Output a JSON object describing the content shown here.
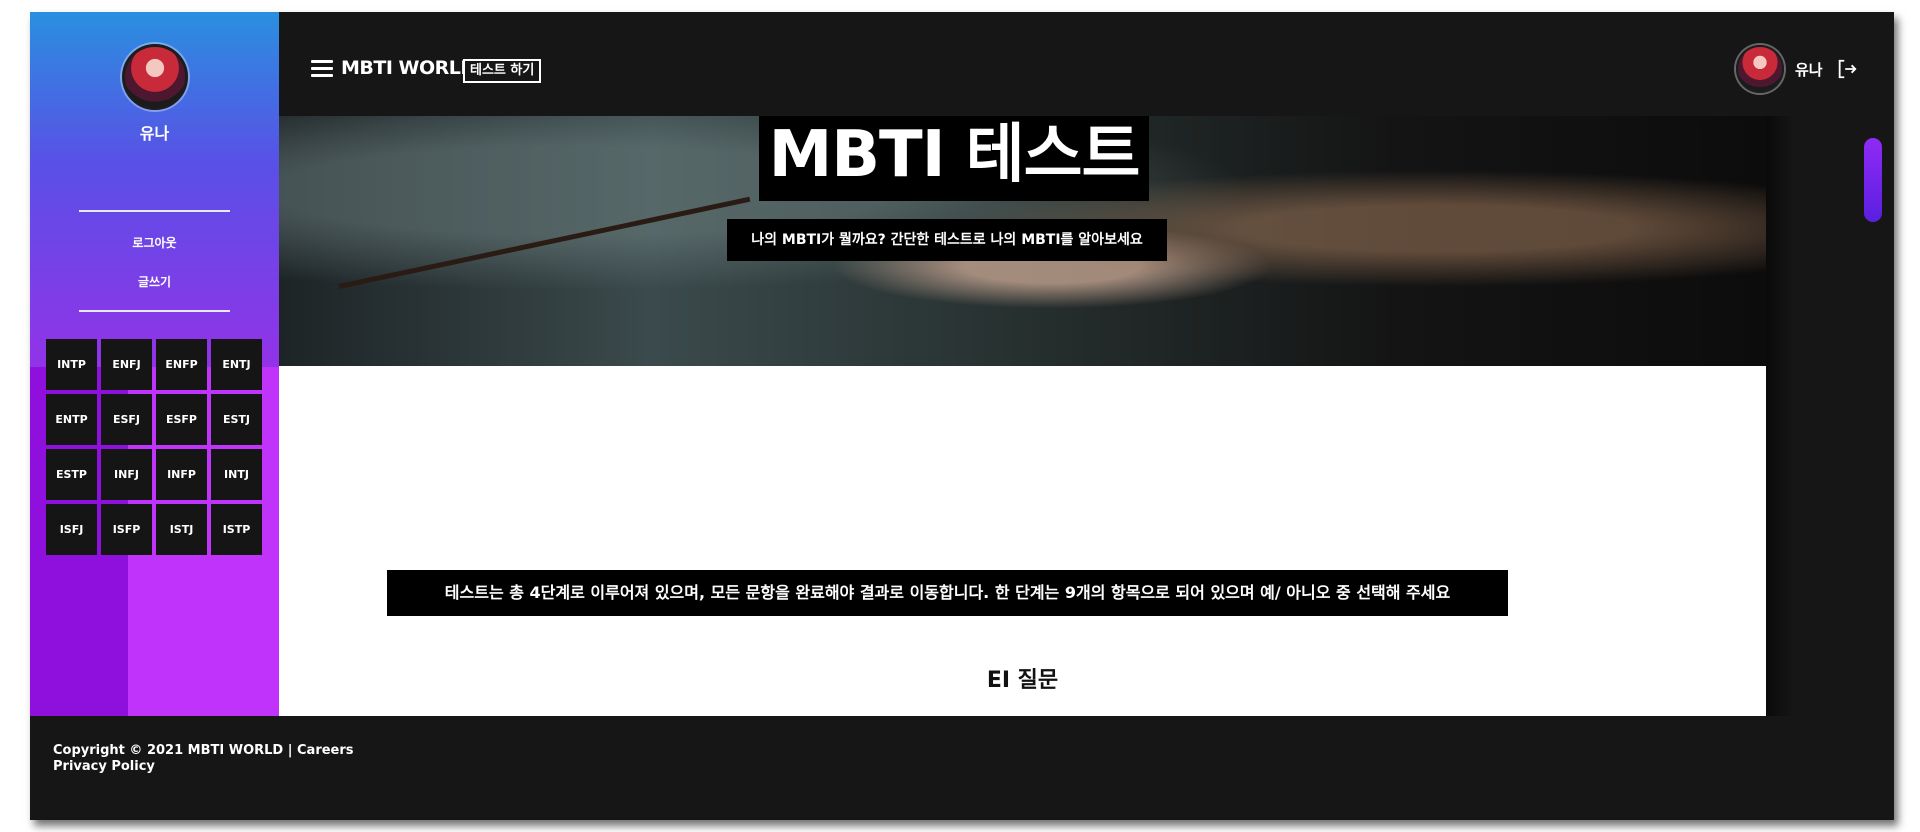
{
  "sidebar": {
    "user_name": "유나",
    "links": [
      "로그아웃",
      "글쓰기"
    ],
    "mbti_types": [
      "INTP",
      "ENFJ",
      "ENFP",
      "ENTJ",
      "ENTP",
      "ESFJ",
      "ESFP",
      "ESTJ",
      "ESTP",
      "INFJ",
      "INFP",
      "INTJ",
      "ISFJ",
      "ISFP",
      "ISTJ",
      "ISTP"
    ]
  },
  "header": {
    "brand": "MBTI WORLD",
    "test_button": "테스트 하기",
    "user_name": "유나",
    "icons": [
      "menu-icon",
      "logout-icon"
    ]
  },
  "hero": {
    "title": "MBTI 테스트",
    "subtitle": "나의 MBTI가 뭘까요? 간단한 테스트로 나의 MBTI를 알아보세요"
  },
  "main": {
    "info": "테스트는 총 4단계로 이루어져 있으며, 모든 문항을 완료해야 결과로 이동합니다. 한 단계는 9개의 항목으로 되어 있으며 예/ 아니오 중 선택해 주세요",
    "section_title": "EI 질문"
  },
  "footer": {
    "line1": "Copyright © 2021 MBTI WORLD | Careers",
    "line2": "Privacy Policy"
  },
  "colors": {
    "frame": "#161616",
    "sidebar_top": "#2a8fe0",
    "sidebar_bottom": "#b030f0",
    "scroll_thumb": "#8f2bf5"
  }
}
